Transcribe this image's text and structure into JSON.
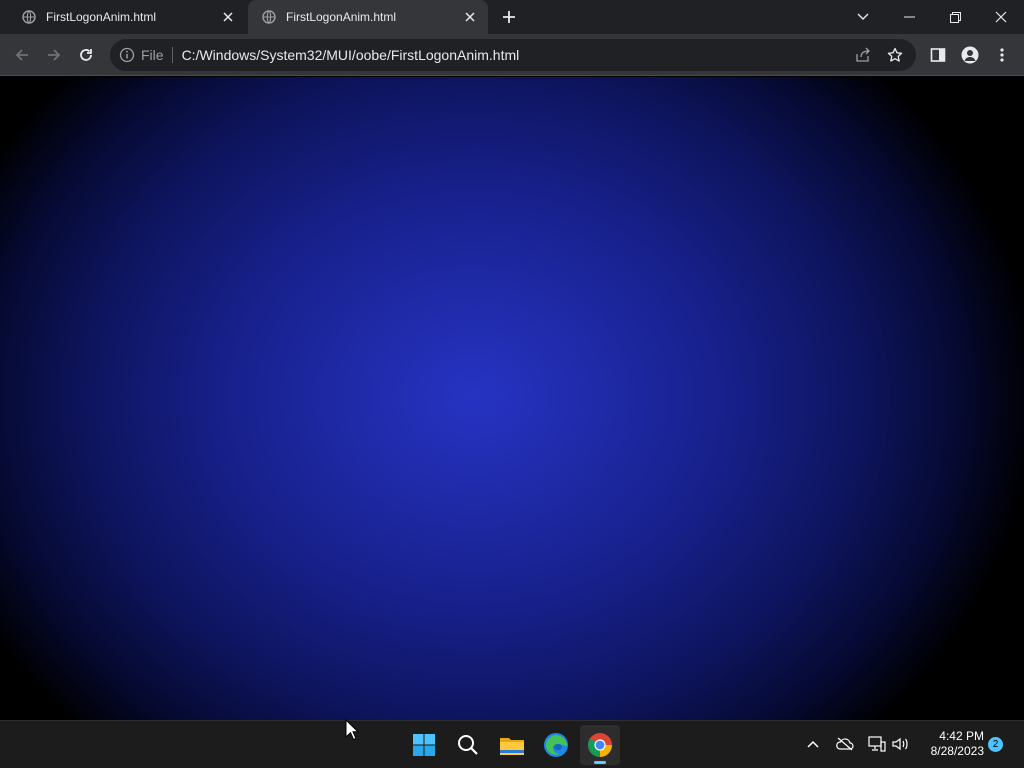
{
  "browser": {
    "tabs": [
      {
        "title": "FirstLogonAnim.html",
        "active": false
      },
      {
        "title": "FirstLogonAnim.html",
        "active": true
      }
    ],
    "address_bar": {
      "scheme_label": "File",
      "url": "C:/Windows/System32/MUI/oobe/FirstLogonAnim.html"
    }
  },
  "taskbar": {
    "apps": [
      {
        "icon": "windows-start-icon"
      },
      {
        "icon": "search-icon"
      },
      {
        "icon": "file-explorer-icon"
      },
      {
        "icon": "edge-icon"
      },
      {
        "icon": "chrome-icon",
        "active": true
      }
    ],
    "clock": {
      "time": "4:42 PM",
      "date": "8/28/2023"
    },
    "notification_count": "2"
  },
  "colors": {
    "page_center": "#2633c2",
    "page_edge": "#000000",
    "tab_strip": "#202124",
    "toolbar": "#35363a",
    "taskbar": "#1c1c1c",
    "accent": "#60cdff"
  }
}
